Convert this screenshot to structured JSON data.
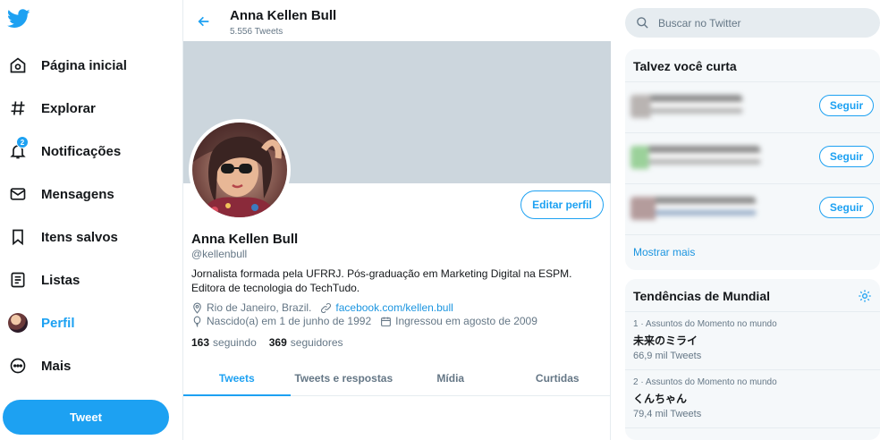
{
  "colors": {
    "accent": "#1da1f2",
    "banner": "#ccd6dd",
    "secondary_text": "#657786"
  },
  "sidebar": {
    "items": [
      {
        "label": "Página inicial",
        "icon": "home-icon"
      },
      {
        "label": "Explorar",
        "icon": "hashtag-icon"
      },
      {
        "label": "Notificações",
        "icon": "bell-icon",
        "badge": "2"
      },
      {
        "label": "Mensagens",
        "icon": "envelope-icon"
      },
      {
        "label": "Itens salvos",
        "icon": "bookmark-icon"
      },
      {
        "label": "Listas",
        "icon": "list-icon"
      },
      {
        "label": "Perfil",
        "icon": "avatar-icon",
        "active": true
      },
      {
        "label": "Mais",
        "icon": "more-icon"
      }
    ],
    "tweet_button": "Tweet"
  },
  "header": {
    "name": "Anna Kellen Bull",
    "tweet_count": "5.556 Tweets"
  },
  "profile": {
    "edit_button": "Editar perfil",
    "name": "Anna Kellen Bull",
    "handle": "@kellenbull",
    "bio": "Jornalista formada pela UFRRJ. Pós-graduação em Marketing Digital na ESPM. Editora de tecnologia do TechTudo.",
    "location": "Rio de Janeiro, Brazil.",
    "website": "facebook.com/kellen.bull",
    "birth": "Nascido(a) em 1 de junho de 1992",
    "joined": "Ingressou em agosto de 2009",
    "following_count": "163",
    "following_label": "seguindo",
    "followers_count": "369",
    "followers_label": "seguidores"
  },
  "tabs": [
    {
      "label": "Tweets",
      "active": true
    },
    {
      "label": "Tweets e respostas"
    },
    {
      "label": "Mídia"
    },
    {
      "label": "Curtidas"
    }
  ],
  "search": {
    "placeholder": "Buscar no Twitter"
  },
  "suggestions": {
    "title": "Talvez você curta",
    "follow_label": "Seguir",
    "show_more": "Mostrar mais"
  },
  "trends": {
    "title": "Tendências de Mundial",
    "items": [
      {
        "meta": "1 · Assuntos do Momento no mundo",
        "name": "未来のミライ",
        "count": "66,9 mil Tweets"
      },
      {
        "meta": "2 · Assuntos do Momento no mundo",
        "name": "くんちゃん",
        "count": "79,4 mil Tweets"
      }
    ]
  }
}
